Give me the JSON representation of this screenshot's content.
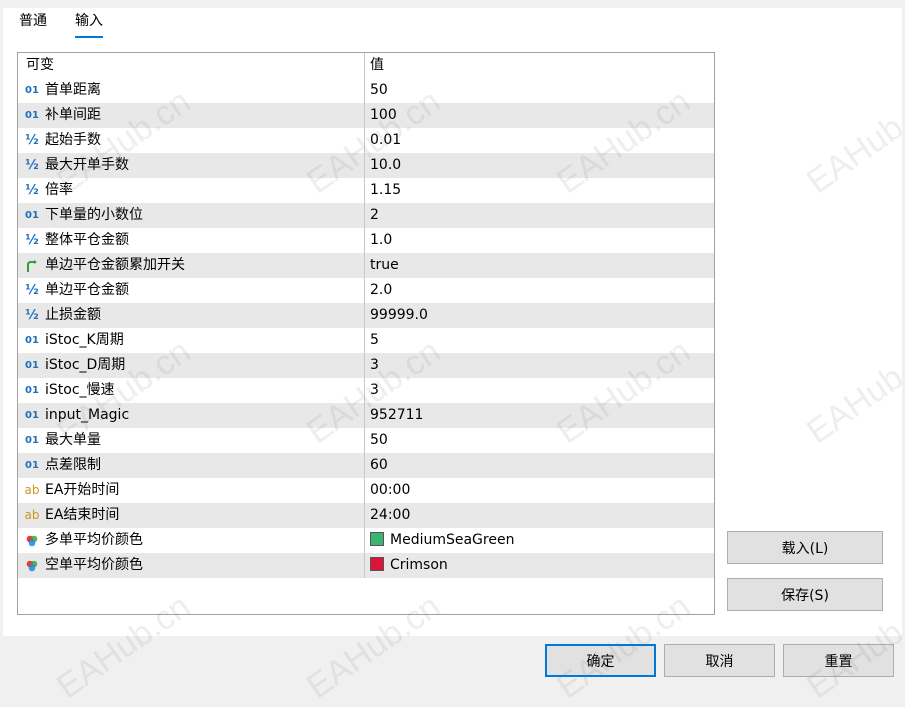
{
  "tabs": [
    {
      "label": "普通",
      "active": false
    },
    {
      "label": "输入",
      "active": true
    }
  ],
  "grid": {
    "header": {
      "name": "可变",
      "value": "值"
    },
    "rows": [
      {
        "type": "int",
        "name": "首单距离",
        "value": "50"
      },
      {
        "type": "int",
        "name": "补单间距",
        "value": "100"
      },
      {
        "type": "double",
        "name": "起始手数",
        "value": "0.01"
      },
      {
        "type": "double",
        "name": "最大开单手数",
        "value": "10.0"
      },
      {
        "type": "double",
        "name": "倍率",
        "value": "1.15"
      },
      {
        "type": "int",
        "name": "下单量的小数位",
        "value": "2"
      },
      {
        "type": "double",
        "name": "整体平仓金额",
        "value": "1.0"
      },
      {
        "type": "bool",
        "name": "单边平仓金额累加开关",
        "value": "true"
      },
      {
        "type": "double",
        "name": "单边平仓金额",
        "value": "2.0"
      },
      {
        "type": "double",
        "name": "止损金额",
        "value": "99999.0"
      },
      {
        "type": "int",
        "name": "iStoc_K周期",
        "value": "5"
      },
      {
        "type": "int",
        "name": "iStoc_D周期",
        "value": "3"
      },
      {
        "type": "int",
        "name": "iStoc_慢速",
        "value": "3"
      },
      {
        "type": "int",
        "name": "input_Magic",
        "value": "952711"
      },
      {
        "type": "int",
        "name": "最大单量",
        "value": "50"
      },
      {
        "type": "int",
        "name": "点差限制",
        "value": "60"
      },
      {
        "type": "string",
        "name": "EA开始时间",
        "value": "00:00"
      },
      {
        "type": "string",
        "name": "EA结束时间",
        "value": "24:00"
      },
      {
        "type": "color",
        "name": "多单平均价颜色",
        "value": "MediumSeaGreen",
        "swatch": "#3cb371"
      },
      {
        "type": "color",
        "name": "空单平均价颜色",
        "value": "Crimson",
        "swatch": "#dc143c"
      }
    ]
  },
  "type_glyphs": {
    "int": "01",
    "double": "½",
    "string": "ab"
  },
  "side_buttons": {
    "load": "载入(L)",
    "save": "保存(S)"
  },
  "footer_buttons": {
    "ok": "确定",
    "cancel": "取消",
    "reset": "重置"
  },
  "watermark": "EAHub.cn",
  "colors": {
    "accent": "#0078d7",
    "icon_blue": "#1f6fbf",
    "icon_gold": "#c89a1e"
  }
}
